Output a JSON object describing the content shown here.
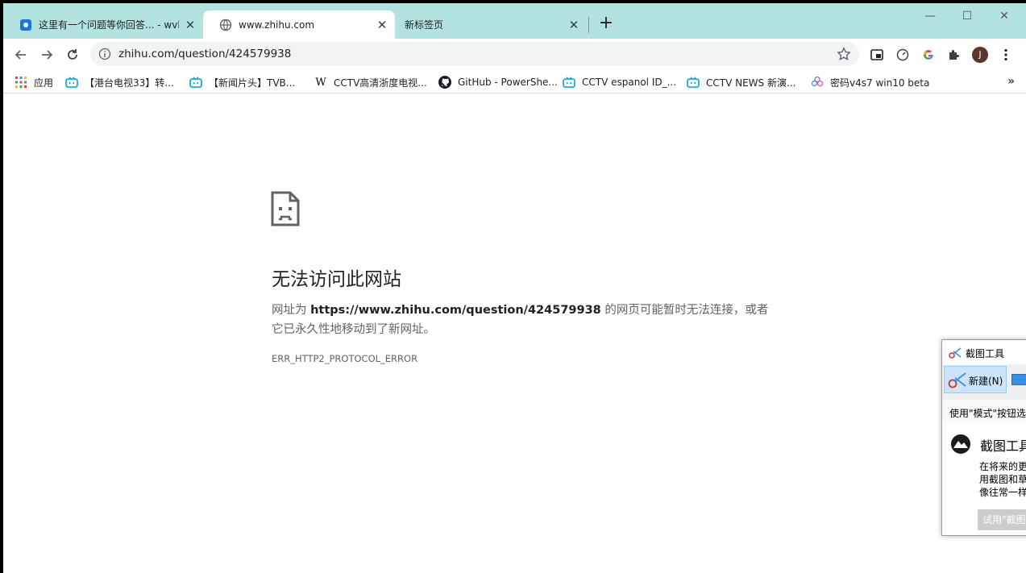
{
  "tabs": [
    {
      "title": "这里有一个问题等你回答... - wvb",
      "icon": "doc-icon",
      "active": false
    },
    {
      "title": "www.zhihu.com",
      "icon": "globe-icon",
      "active": true
    },
    {
      "title": "新标签页",
      "icon": "",
      "active": false
    }
  ],
  "new_tab_label": "+",
  "window_controls": {
    "minimize": "—",
    "maximize": "☐",
    "close": "✕"
  },
  "address_bar": {
    "url": "zhihu.com/question/424579938"
  },
  "bookmarks": {
    "apps_label": "应用",
    "items": [
      {
        "label": "【港台电视33】转...",
        "icon": "bilibili-icon"
      },
      {
        "label": "【新闻片头】TVB...",
        "icon": "bilibili-icon"
      },
      {
        "label": "CCTV高清浙度电视...",
        "icon": "wikipedia-icon"
      },
      {
        "label": "GitHub - PowerShe...",
        "icon": "github-icon"
      },
      {
        "label": "CCTV espanol ID_...",
        "icon": "bilibili-icon"
      },
      {
        "label": "CCTV NEWS 新演...",
        "icon": "bilibili-icon"
      },
      {
        "label": "密码v4s7 win10 beta",
        "icon": "flower-icon"
      }
    ],
    "more": "»"
  },
  "error_page": {
    "title": "无法访问此网站",
    "desc_prefix": "网址为 ",
    "desc_url": "https://www.zhihu.com/question/424579938",
    "desc_suffix": " 的网页可能暂时无法连接，或者它已永久性地移动到了新网址。",
    "code": "ERR_HTTP2_PROTOCOL_ERROR"
  },
  "snipping_tool": {
    "title": "截图工具",
    "new_button": "新建(N)",
    "hint": "使用\"模式\"按钮选",
    "promo_title": "截图工具",
    "promo_body": [
      "在将来的更",
      "用截图和草",
      "像往常一样"
    ],
    "try_button": "试用\"截图"
  },
  "colors": {
    "tabstrip": "#b3e3e0",
    "accent_blue": "#1a73e8"
  }
}
